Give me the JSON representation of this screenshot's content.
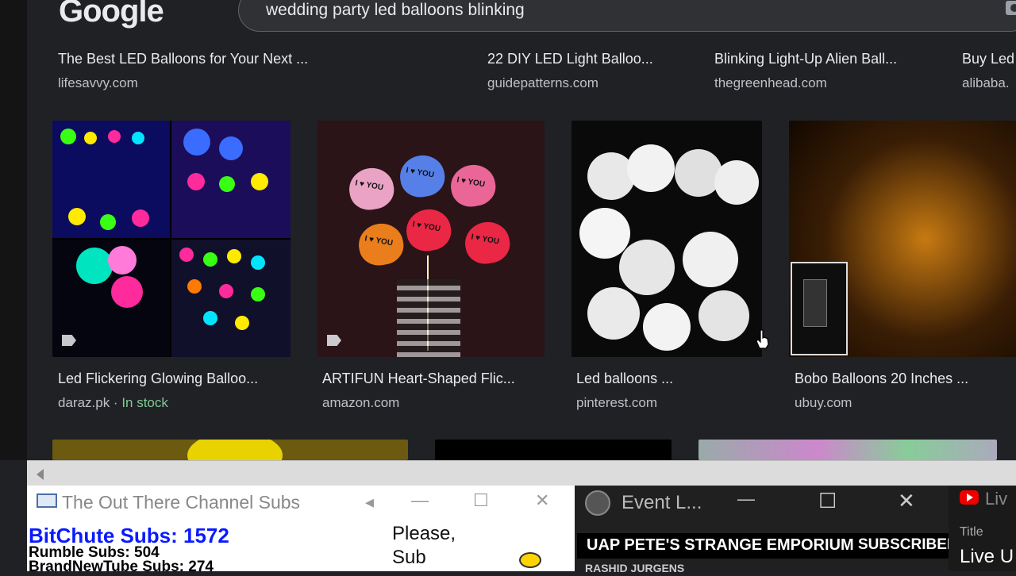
{
  "browser": {
    "logo": "Google",
    "search_query": "wedding party led balloons blinking"
  },
  "top_results": [
    {
      "title": "The Best LED Balloons for Your Next ...",
      "source": "lifesavvy.com"
    },
    {
      "title": "22 DIY LED Light Balloo...",
      "source": "guidepatterns.com"
    },
    {
      "title": "Blinking Light-Up Alien Ball...",
      "source": "thegreenhead.com"
    },
    {
      "title": "Buy Led",
      "source": "alibaba."
    }
  ],
  "results": [
    {
      "title": "Led Flickering Glowing Balloo...",
      "source": "daraz.pk",
      "separator": " · ",
      "badge": "In stock"
    },
    {
      "title": "ARTIFUN Heart-Shaped Flic...",
      "source": "amazon.com"
    },
    {
      "title": "Led balloons ...",
      "source": "pinterest.com"
    },
    {
      "title": "Bobo Balloons 20 Inches ...",
      "source": "ubuy.com"
    }
  ],
  "heart_label": "I ♥ YOU",
  "win_subs": {
    "title": "The Out There Channel Subs",
    "bitchute": "BitChute Subs: 1572",
    "rumble": "Rumble Subs: 504",
    "brandnewtube": "BrandNewTube Subs: 274",
    "please_line1": "Please,",
    "please_line2": "Sub"
  },
  "win_event": {
    "title": "Event L...",
    "banner": "UAP PETE'S STRANGE EMPORIUM",
    "banner_right": "SUBSCRIBER",
    "next_line": "RASHID JURGENS"
  },
  "win_youtube": {
    "title": "Liv",
    "label": "Title",
    "value": "Live U"
  },
  "colors": {
    "page_bg": "#202124",
    "subs_text": "#0a1aff",
    "in_stock": "#81c995"
  }
}
